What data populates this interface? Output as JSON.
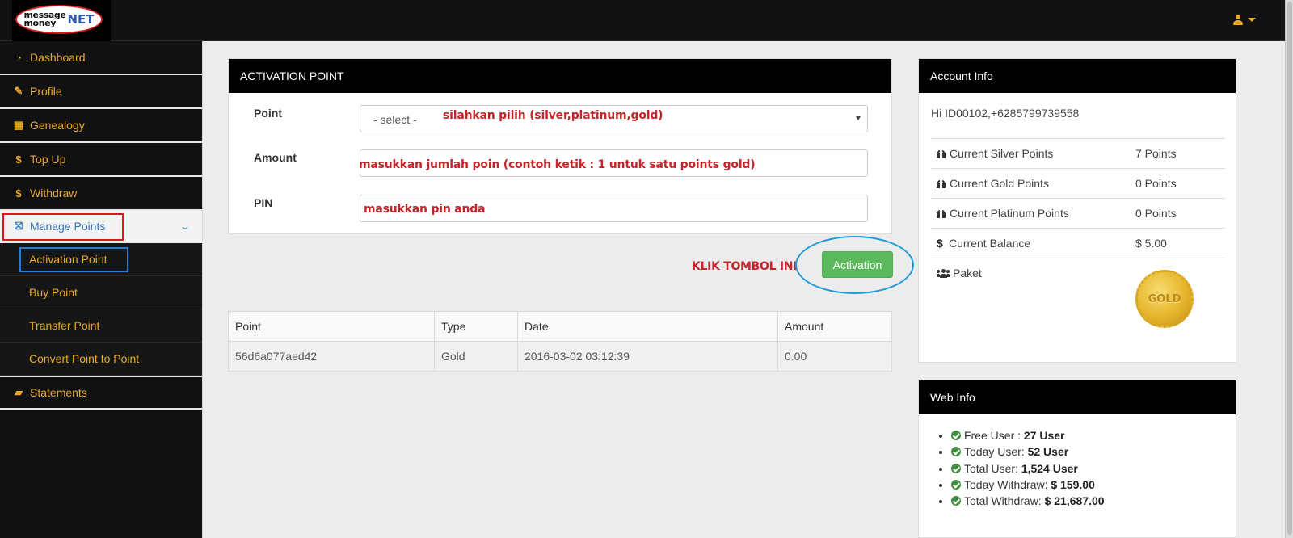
{
  "brand": {
    "logo_line1": "message",
    "logo_line2": "money",
    "logo_net": "NET"
  },
  "sidebar": {
    "items": [
      {
        "label": "Dashboard",
        "icon": "dashboard-icon"
      },
      {
        "label": "Profile",
        "icon": "wrench-icon"
      },
      {
        "label": "Genealogy",
        "icon": "table-icon"
      },
      {
        "label": "Top Up",
        "icon": "dollar-icon"
      },
      {
        "label": "Withdraw",
        "icon": "dollar-icon"
      },
      {
        "label": "Manage Points",
        "icon": "gift-icon"
      },
      {
        "label": "Statements",
        "icon": "book-icon"
      }
    ],
    "sub_items": [
      {
        "label": "Activation Point"
      },
      {
        "label": "Buy Point"
      },
      {
        "label": "Transfer Point"
      },
      {
        "label": "Convert Point to Point"
      }
    ]
  },
  "activation": {
    "title": "ACTIVATION POINT",
    "point_label": "Point",
    "point_select_value": "- select -",
    "amount_label": "Amount",
    "pin_label": "PIN",
    "hint_point": "silahkan pilih (silver,platinum,gold)",
    "hint_amount": "masukkan jumlah poin (contoh ketik : 1 untuk satu points gold)",
    "hint_pin": "masukkan pin anda",
    "klik_text": "KLIK TOMBOL INI",
    "button_label": "Activation"
  },
  "points_table": {
    "headers": [
      "Point",
      "Type",
      "Date",
      "Amount"
    ],
    "rows": [
      [
        "56d6a077aed42",
        "Gold",
        "2016-03-02 03:12:39",
        "0.00"
      ]
    ]
  },
  "account_info": {
    "title": "Account Info",
    "greeting": "Hi ID00102,+6285799739558",
    "rows": [
      {
        "label": "Current Silver Points",
        "value": "7 Points"
      },
      {
        "label": "Current Gold Points",
        "value": "0 Points"
      },
      {
        "label": "Current Platinum Points",
        "value": "0 Points"
      },
      {
        "label": "Current Balance",
        "value": "$ 5.00"
      }
    ],
    "paket_label": "Paket",
    "paket_badge": "GOLD"
  },
  "web_info": {
    "title": "Web Info",
    "items": [
      {
        "label": "Free User : ",
        "value": "27 User"
      },
      {
        "label": "Today User: ",
        "value": "52 User"
      },
      {
        "label": "Total User: ",
        "value": "1,524 User"
      },
      {
        "label": "Today Withdraw: ",
        "value": "$ 159.00"
      },
      {
        "label": "Total Withdraw: ",
        "value": "$ 21,687.00"
      }
    ]
  },
  "colors": {
    "accent": "#e9a825",
    "active": "#3277b5",
    "success": "#5cb85c",
    "annotation_red": "#c4252a",
    "annotation_blue": "#1e9bd8"
  }
}
